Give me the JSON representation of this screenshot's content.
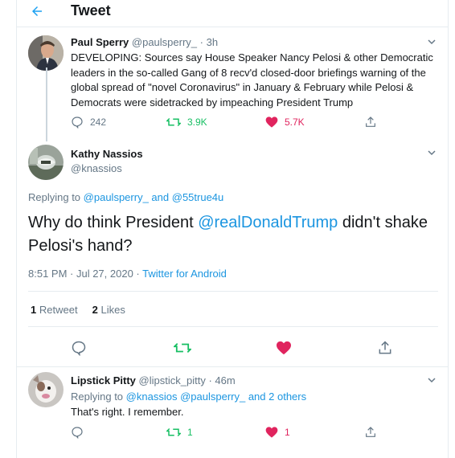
{
  "header": {
    "title": "Tweet",
    "back_icon": "back-arrow-icon"
  },
  "colors": {
    "accent": "#1da1f2",
    "link": "#1b95e0",
    "like": "#e0245e",
    "retweet": "#17bf63",
    "muted": "#657786"
  },
  "parent_tweet": {
    "name": "Paul Sperry",
    "handle": "@paulsperry_",
    "separator": "·",
    "time": "3h",
    "text": "DEVELOPING: Sources say House Speaker Nancy Pelosi & other Democratic leaders in the so-called Gang of 8 recv'd closed-door briefings warning of the global spread of \"novel Coronavirus\" in January & February while Pelosi & Democrats were sidetracked by impeaching President Trump",
    "replies": "242",
    "retweets": "3.9K",
    "likes": "5.7K"
  },
  "main_tweet": {
    "name": "Kathy Nassios",
    "handle": "@knassios",
    "replying_label": "Replying to",
    "reply_to_1": "@paulsperry_",
    "and": "and",
    "reply_to_2": "@55true4u",
    "text_before": "Why do think President ",
    "mention": "@realDonaldTrump",
    "text_after": " didn't shake Pelosi's hand?",
    "timestamp": "8:51 PM · Jul 27, 2020 · ",
    "source": "Twitter for Android",
    "retweet_count": "1",
    "retweet_label": "Retweet",
    "like_count": "2",
    "like_label": "Likes"
  },
  "reply_tweet": {
    "name": "Lipstick Pitty",
    "handle": "@lipstick_pitty",
    "separator": "·",
    "time": "46m",
    "replying_label": "Replying to",
    "reply_to_1": "@knassios",
    "reply_to_2": "@paulsperry_",
    "and_others": "and 2 others",
    "text": "That's right. I remember.",
    "retweets": "1",
    "likes": "1"
  }
}
